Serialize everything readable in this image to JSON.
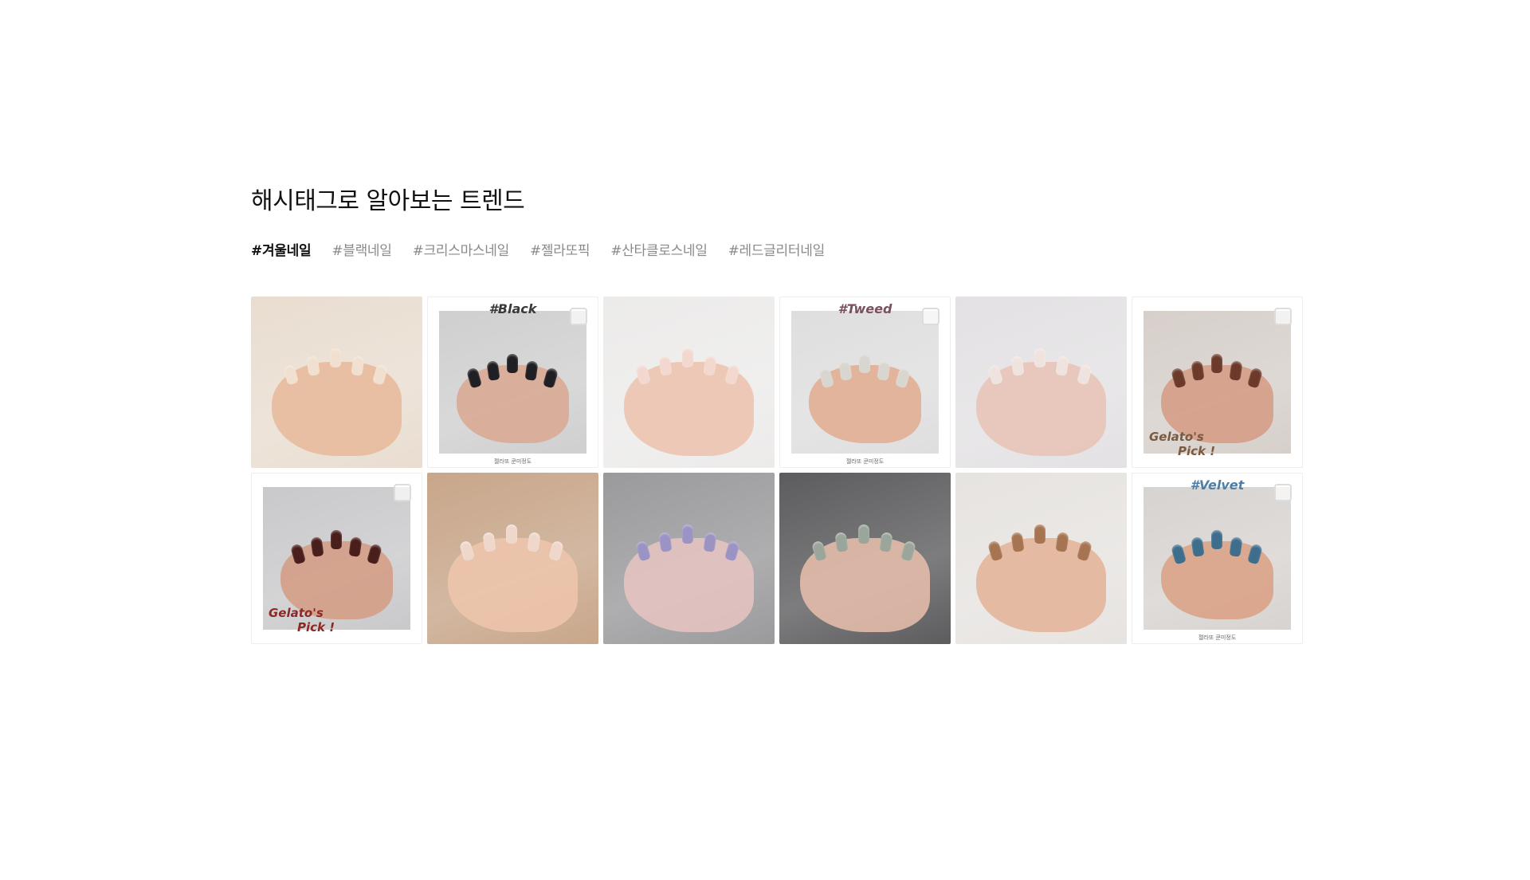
{
  "section": {
    "title": "해시태그로 알아보는 트렌드",
    "tags": [
      {
        "label": "#겨울네일",
        "active": true
      },
      {
        "label": "#블랙네일",
        "active": false
      },
      {
        "label": "#크리스마스네일",
        "active": false
      },
      {
        "label": "#젤라또픽",
        "active": false
      },
      {
        "label": "#산타클로스네일",
        "active": false
      },
      {
        "label": "#레드글리터네일",
        "active": false
      }
    ]
  },
  "gallery": {
    "tiles": [
      {
        "overlay_tag": "",
        "pick_line1": "",
        "pick_line2": "",
        "caption": "",
        "bg": "#e9ddd0",
        "hand": "#e8b89a",
        "nail": "#f1e0cf"
      },
      {
        "overlay_tag": "#Black",
        "pick_line1": "",
        "pick_line2": "",
        "caption": "젤라또 쿤미정도",
        "bg": "#cfcfcf",
        "hand": "#d9a892",
        "nail": "#1f1f24"
      },
      {
        "overlay_tag": "",
        "pick_line1": "",
        "pick_line2": "",
        "caption": "",
        "bg": "#ecebea",
        "hand": "#ecc1ad",
        "nail": "#f3d8cf"
      },
      {
        "overlay_tag": "#Tweed",
        "pick_line1": "",
        "pick_line2": "",
        "caption": "젤라또 쿤미정도",
        "bg": "#dedede",
        "hand": "#e2ac8f",
        "nail": "#d8d6cf"
      },
      {
        "overlay_tag": "",
        "pick_line1": "",
        "pick_line2": "",
        "caption": "",
        "bg": "#e3e1e3",
        "hand": "#e8c2b4",
        "nail": "#efe3df"
      },
      {
        "overlay_tag": "",
        "pick_line1": "Gelato's",
        "pick_line2": "Pick !",
        "caption": "",
        "bg": "#d6cfca",
        "hand": "#d59a83",
        "nail": "#6b3a2a"
      },
      {
        "overlay_tag": "",
        "pick_line1": "Gelato's",
        "pick_line2": "Pick !",
        "caption": "",
        "bg": "#c9c9cb",
        "hand": "#d49b83",
        "nail": "#4a1e1a"
      },
      {
        "overlay_tag": "",
        "pick_line1": "",
        "pick_line2": "",
        "caption": "",
        "bg": "#c8a68a",
        "hand": "#efc6ad",
        "nail": "#efd8cb"
      },
      {
        "overlay_tag": "",
        "pick_line1": "",
        "pick_line2": "",
        "caption": "",
        "bg": "#9a9a9c",
        "hand": "#e7c5c2",
        "nail": "#9b93c3"
      },
      {
        "overlay_tag": "",
        "pick_line1": "",
        "pick_line2": "",
        "caption": "",
        "bg": "#5c5c5e",
        "hand": "#e9c0ac",
        "nail": "#9aa69a"
      },
      {
        "overlay_tag": "",
        "pick_line1": "",
        "pick_line2": "",
        "caption": "",
        "bg": "#e6e3e0",
        "hand": "#e4b296",
        "nail": "#a67450"
      },
      {
        "overlay_tag": "#Velvet",
        "pick_line1": "",
        "pick_line2": "",
        "caption": "젤라또 쿤미정도",
        "bg": "#d7d3d0",
        "hand": "#dba083",
        "nail": "#3f6d8c"
      }
    ]
  }
}
